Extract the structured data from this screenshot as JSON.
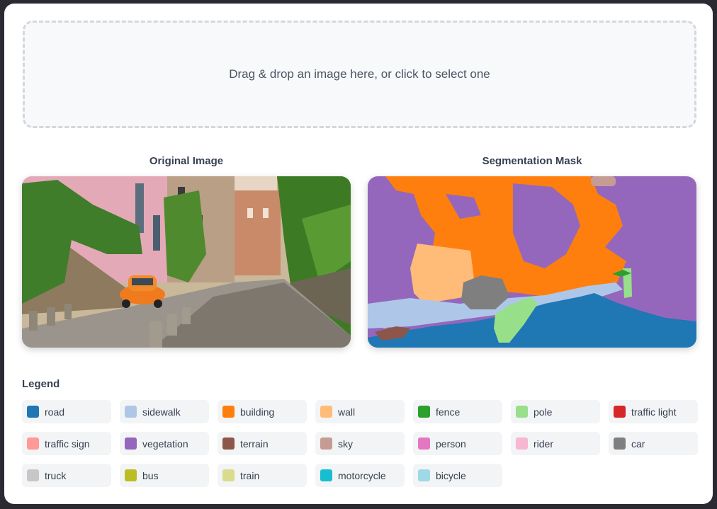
{
  "dropzone": {
    "text": "Drag & drop an image here, or click to select one"
  },
  "original": {
    "title": "Original Image"
  },
  "mask": {
    "title": "Segmentation Mask"
  },
  "legend": {
    "title": "Legend",
    "items": [
      {
        "label": "road",
        "color": "#1f77b4",
        "icon": "road-swatch"
      },
      {
        "label": "sidewalk",
        "color": "#aec7e8",
        "icon": "sidewalk-swatch"
      },
      {
        "label": "building",
        "color": "#ff7f0e",
        "icon": "building-swatch"
      },
      {
        "label": "wall",
        "color": "#ffbb78",
        "icon": "wall-swatch"
      },
      {
        "label": "fence",
        "color": "#2ca02c",
        "icon": "fence-swatch"
      },
      {
        "label": "pole",
        "color": "#98df8a",
        "icon": "pole-swatch"
      },
      {
        "label": "traffic light",
        "color": "#d62728",
        "icon": "traffic-light-swatch"
      },
      {
        "label": "traffic sign",
        "color": "#ff9896",
        "icon": "traffic-sign-swatch"
      },
      {
        "label": "vegetation",
        "color": "#9467bd",
        "icon": "vegetation-swatch"
      },
      {
        "label": "terrain",
        "color": "#8c564b",
        "icon": "terrain-swatch"
      },
      {
        "label": "sky",
        "color": "#c49c94",
        "icon": "sky-swatch"
      },
      {
        "label": "person",
        "color": "#e377c2",
        "icon": "person-swatch"
      },
      {
        "label": "rider",
        "color": "#f7b6d2",
        "icon": "rider-swatch"
      },
      {
        "label": "car",
        "color": "#7f7f7f",
        "icon": "car-swatch"
      },
      {
        "label": "truck",
        "color": "#c7c7c7",
        "icon": "truck-swatch"
      },
      {
        "label": "bus",
        "color": "#bcbd22",
        "icon": "bus-swatch"
      },
      {
        "label": "train",
        "color": "#dbdb8d",
        "icon": "train-swatch"
      },
      {
        "label": "motorcycle",
        "color": "#17becf",
        "icon": "motorcycle-swatch"
      },
      {
        "label": "bicycle",
        "color": "#9edae5",
        "icon": "bicycle-swatch"
      }
    ]
  }
}
